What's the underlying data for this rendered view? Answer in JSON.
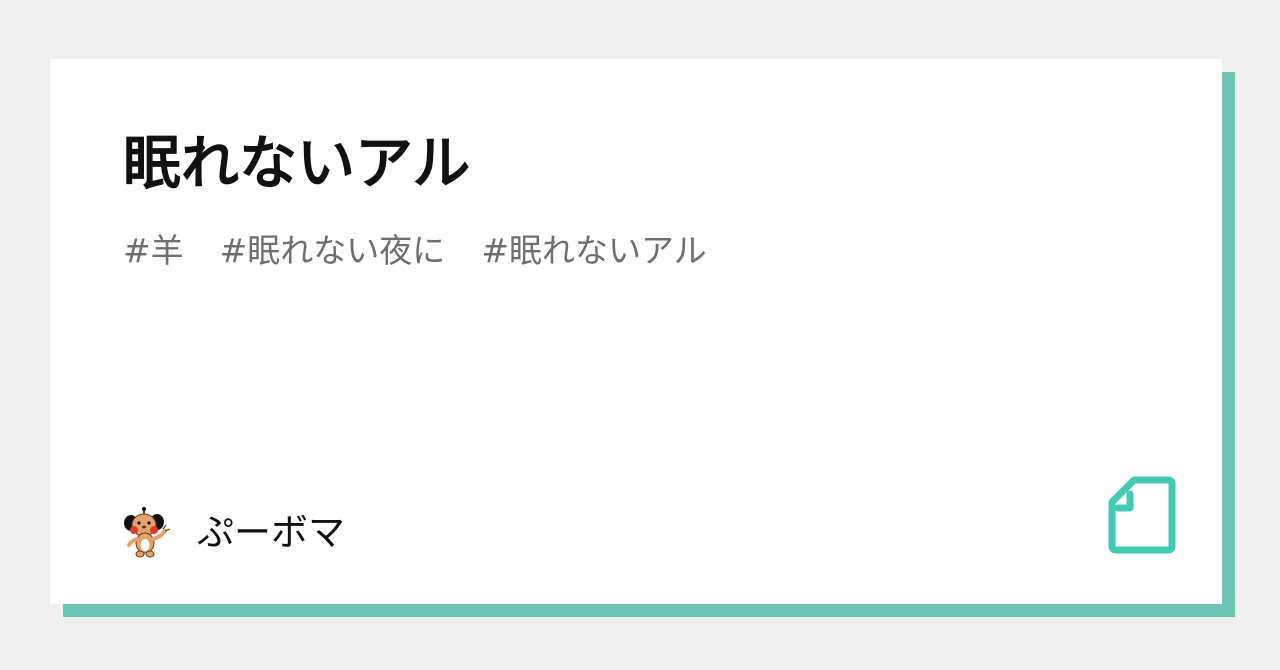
{
  "article": {
    "title": "眠れないアル",
    "tags": [
      "#羊",
      "#眠れない夜に",
      "#眠れないアル"
    ]
  },
  "author": {
    "name": "ぷーボマ",
    "avatar_icon": "puppy-character-icon"
  },
  "brand": {
    "logo_icon": "note-document-icon",
    "accent": "#6cc4b4",
    "logo_color": "#41c9b4"
  },
  "colors": {
    "background": "#efefef",
    "card": "#ffffff",
    "title_text": "#111111",
    "tag_text": "#6f6f6f"
  }
}
